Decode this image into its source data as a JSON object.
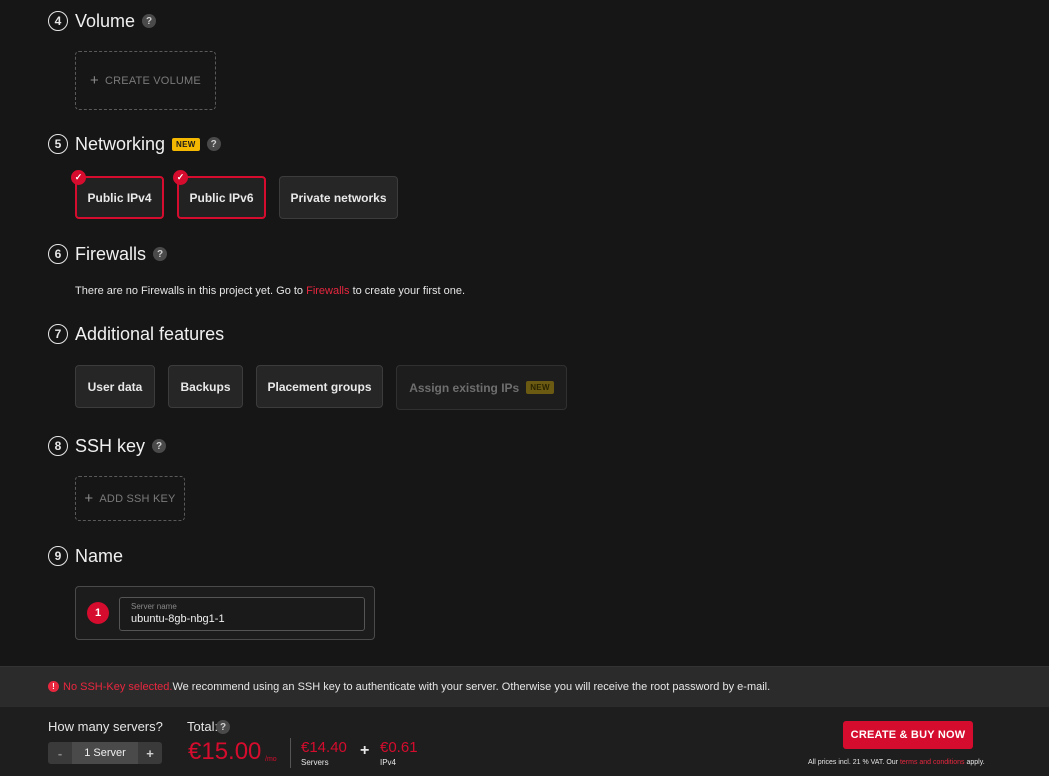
{
  "sections": {
    "volume": {
      "num": "4",
      "title": "Volume",
      "help": "?",
      "create_label": "CREATE VOLUME"
    },
    "networking": {
      "num": "5",
      "title": "Networking",
      "badge": "NEW",
      "help": "?",
      "options": [
        {
          "label": "Public IPv4",
          "selected": true
        },
        {
          "label": "Public IPv6",
          "selected": true
        },
        {
          "label": "Private networks",
          "selected": false
        }
      ]
    },
    "firewalls": {
      "num": "6",
      "title": "Firewalls",
      "help": "?",
      "text_before": "There are no Firewalls in this project yet. Go to ",
      "link": "Firewalls",
      "text_after": " to create your first one."
    },
    "additional": {
      "num": "7",
      "title": "Additional features",
      "options": [
        "User data",
        "Backups",
        "Placement groups",
        "Assign existing IPs"
      ],
      "assign_badge": "NEW"
    },
    "ssh": {
      "num": "8",
      "title": "SSH key",
      "help": "?",
      "add_label": "ADD SSH KEY"
    },
    "name": {
      "num": "9",
      "title": "Name",
      "server_index": "1",
      "field_label": "Server name",
      "field_value": "ubuntu-8gb-nbg1-1"
    }
  },
  "warning": {
    "icon": "!",
    "highlight": "No SSH-Key selected.",
    "text": " We recommend using an SSH key to authenticate with your server. Otherwise you will receive the root password by e-mail."
  },
  "footer": {
    "servers_label": "How many servers?",
    "stepper_minus": "-",
    "stepper_value": "1 Server",
    "stepper_plus": "+",
    "total_label": "Total:",
    "total_help": "?",
    "total_price": "€15.00",
    "total_unit": "/mo",
    "servers_price": "€14.40",
    "servers_caption": "Servers",
    "plus": "+",
    "ipv4_price": "€0.61",
    "ipv4_caption": "IPv4",
    "buy_button": "CREATE & BUY NOW",
    "vat_before": "All prices incl. 21 % VAT. Our ",
    "vat_link": "terms and conditions",
    "vat_after": " apply."
  },
  "colors": {
    "accent": "#d50c2d",
    "badge": "#f5b800",
    "background": "#161616"
  },
  "icons": {
    "check": "check-icon",
    "plus": "plus-icon",
    "help": "help-icon",
    "warning": "warning-icon"
  }
}
